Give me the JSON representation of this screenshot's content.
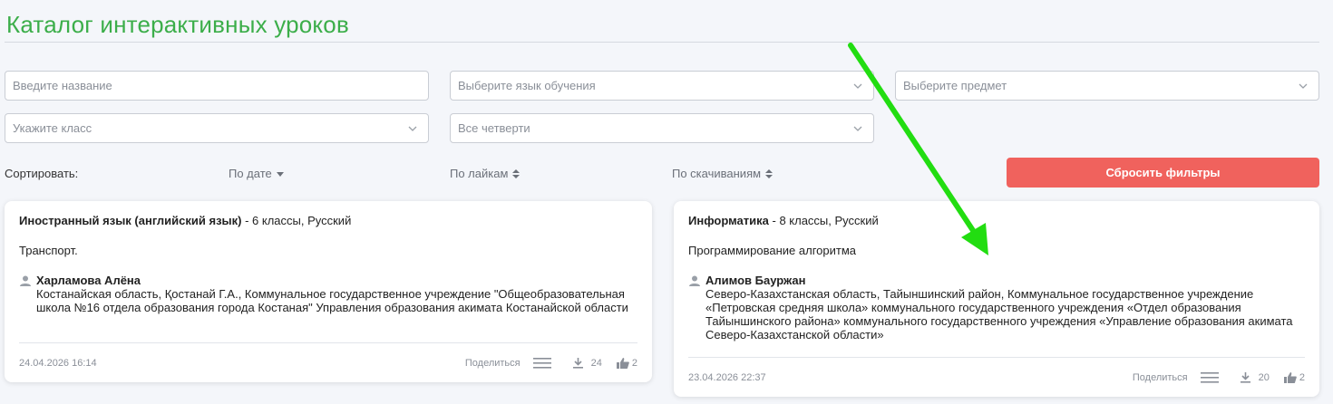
{
  "page": {
    "title": "Каталог интерактивных уроков"
  },
  "filters": {
    "name": {
      "placeholder": "Введите название",
      "value": ""
    },
    "language": {
      "placeholder": "Выберите язык обучения"
    },
    "subject": {
      "placeholder": "Выберите предмет"
    },
    "grade": {
      "placeholder": "Укажите класс"
    },
    "quarter": {
      "value": "Все четверти"
    }
  },
  "sort": {
    "label": "Сортировать:",
    "by_date": "По дате",
    "by_likes": "По лайкам",
    "by_downloads": "По скачиваниям"
  },
  "reset_label": "Сбросить фильтры",
  "cards": [
    {
      "subject": "Иностранный язык (английский язык)",
      "meta": " - 6 классы, Русский",
      "topic": "Транспорт.",
      "author": "Харламова Алёна",
      "org": "Костанайская область, Қостанай Г.А., Коммунальное государственное учреждение \"Общеобразовательная школа №16 отдела образования города Костаная\" Управления образования акимата Костанайской области",
      "date": "24.04.2026 16:14",
      "share": "Поделиться",
      "downloads": "24",
      "likes": "2"
    },
    {
      "subject": "Информатика",
      "meta": " - 8 классы, Русский",
      "topic": "Программирование алгоритма",
      "author": "Алимов Бауржан",
      "org": "Северо-Казахстанская область, Тайыншинский район, Коммунальное государственное учреждение «Петровская средняя школа» коммунального государственного учреждения «Отдел образования Тайыншинского района» коммунального государственного учреждения «Управление образования акимата Северо-Казахстанской области»",
      "date": "23.04.2026 22:37",
      "share": "Поделиться",
      "downloads": "20",
      "likes": "2"
    }
  ],
  "colors": {
    "accent": "#3cae4a",
    "reset": "#f0625d",
    "annotation_arrow": "#22dd11"
  }
}
